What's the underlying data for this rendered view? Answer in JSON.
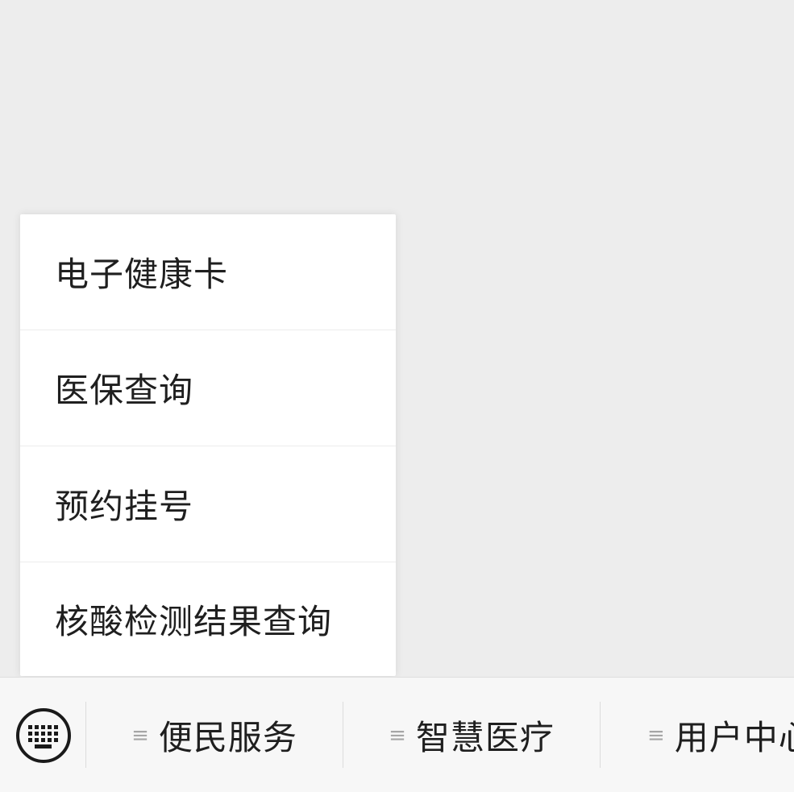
{
  "popup": {
    "items": [
      {
        "label": "电子健康卡"
      },
      {
        "label": "医保查询"
      },
      {
        "label": "预约挂号"
      },
      {
        "label": "核酸检测结果查询"
      }
    ]
  },
  "menubar": {
    "keyboard_icon": "keyboard-icon",
    "tab_glyph": "≡",
    "tabs": [
      {
        "label": "便民服务"
      },
      {
        "label": "智慧医疗"
      },
      {
        "label": "用户中心"
      }
    ]
  },
  "colors": {
    "background": "#ededed",
    "popup_bg": "#ffffff",
    "menubar_bg": "#f7f7f7",
    "text": "#1f1f1f",
    "glyph": "#a6a6a6"
  }
}
